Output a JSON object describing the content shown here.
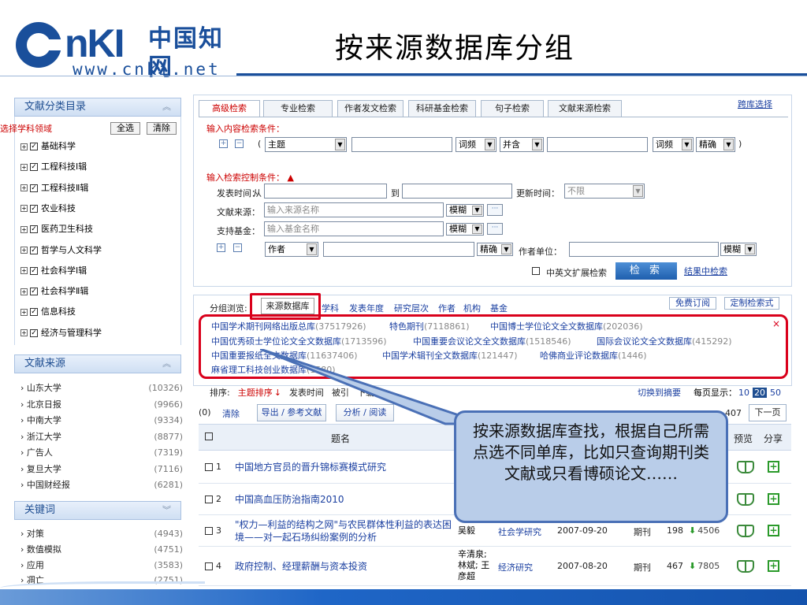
{
  "header": {
    "logo_text": "CNKI中国知网",
    "logo_url": "www.cnki.net",
    "page_title": "按来源数据库分组"
  },
  "sidebar": {
    "category_title": "文献分类目录",
    "pick_label": "选择学科领域",
    "select_all": "全选",
    "clear": "清除",
    "categories": [
      "基础科学",
      "工程科技Ⅰ辑",
      "工程科技Ⅱ辑",
      "农业科技",
      "医药卫生科技",
      "哲学与人文科学",
      "社会科学Ⅰ辑",
      "社会科学Ⅱ辑",
      "信息科技",
      "经济与管理科学"
    ],
    "source_title": "文献来源",
    "sources": [
      {
        "name": "山东大学",
        "count": "(10326)"
      },
      {
        "name": "北京日报",
        "count": "(9966)"
      },
      {
        "name": "中南大学",
        "count": "(9334)"
      },
      {
        "name": "浙江大学",
        "count": "(8877)"
      },
      {
        "name": "广告人",
        "count": "(7319)"
      },
      {
        "name": "复旦大学",
        "count": "(7116)"
      },
      {
        "name": "中国财经报",
        "count": "(6281)"
      }
    ],
    "keyword_title": "关键词",
    "keywords": [
      {
        "name": "对策",
        "count": "(4943)"
      },
      {
        "name": "数值模拟",
        "count": "(4751)"
      },
      {
        "name": "应用",
        "count": "(3583)"
      },
      {
        "name": "凋亡",
        "count": "(2751)"
      }
    ]
  },
  "search": {
    "tabs": [
      "高级检索",
      "专业检索",
      "作者发文检索",
      "科研基金检索",
      "句子检索",
      "文献来源检索"
    ],
    "cross_lib": "跨库选择",
    "content_cond_label": "输入内容检索条件：",
    "paren_open": "(",
    "paren_close": ")",
    "field1": "主题",
    "freq1": "词频",
    "logic": "并含",
    "freq2": "词频",
    "match2": "精确",
    "control_cond_label": "输入检索控制条件：",
    "pub_time_label": "发表时间：",
    "from": "从",
    "to": "到",
    "update_time_label": "更新时间：",
    "update_time_value": "不限",
    "source_label": "文献来源：",
    "source_placeholder": "输入来源名称",
    "source_match": "模糊",
    "fund_label": "支持基金：",
    "fund_placeholder": "输入基金名称",
    "fund_match": "模糊",
    "author_field": "作者",
    "author_match": "精确",
    "author_unit_label": "作者单位：",
    "unit_match": "模糊",
    "ext_label": "中英文扩展检索",
    "search_button": "检 索",
    "in_result": "结果中检索"
  },
  "grouping": {
    "label": "分组浏览:",
    "active_tab": "来源数据库",
    "links": [
      "学科",
      "发表年度",
      "研究层次",
      "作者",
      "机构",
      "基金"
    ],
    "free_sub": "免费订阅",
    "custom_sub": "定制检索式",
    "databases": [
      {
        "name": "中国学术期刊网络出版总库",
        "count": "(37517926)"
      },
      {
        "name": "特色期刊",
        "count": "(7118861)"
      },
      {
        "name": "中国博士学位论文全文数据库",
        "count": "(202036)"
      },
      {
        "name": "中国优秀硕士学位论文全文数据库",
        "count": "(1713596)"
      },
      {
        "name": "中国重要会议论文全文数据库",
        "count": "(1518546)"
      },
      {
        "name": "国际会议论文全文数据库",
        "count": "(415292)"
      },
      {
        "name": "中国重要报纸全文数据库",
        "count": "(11637406)"
      },
      {
        "name": "中国学术辑刊全文数据库",
        "count": "(121447)"
      },
      {
        "name": "哈佛商业评论数据库",
        "count": "(1446)"
      },
      {
        "name": "麻省理工科技创业数据库",
        "count": "(1580)"
      }
    ],
    "close": "×"
  },
  "results": {
    "sort_label": "排序:",
    "sort_options": [
      "主题排序",
      "发表时间",
      "被引",
      "下载"
    ],
    "sort_arrow": "↓",
    "view_summary": "切换到摘要",
    "per_page_label": "每页显示：",
    "per_page_opts": [
      "10",
      "20",
      "50"
    ],
    "selected_prefix": "(0)",
    "clear": "清除",
    "export": "导出 / 参考文献",
    "analyze": "分析 / 阅读",
    "page_count": "407",
    "next_page": "下一页",
    "col_title": "题名",
    "col_preview": "预览",
    "col_share": "分享",
    "rows": [
      {
        "num": "1",
        "title": "中国地方官员的晋升锦标赛模式研究",
        "author": "",
        "source": "",
        "date": "",
        "type": "",
        "cite": "",
        "dl": ""
      },
      {
        "num": "2",
        "title": "中国高血压防治指南2010",
        "author": "",
        "source": "",
        "date": "",
        "type": "",
        "cite": "",
        "dl": ""
      },
      {
        "num": "3",
        "title": "\"权力—利益的结构之网\"与农民群体性利益的表达困境——对一起石场纠纷案例的分析",
        "author": "吴毅",
        "source": "社会学研究",
        "date": "2007-09-20",
        "type": "期刊",
        "cite": "198",
        "dl": "4506"
      },
      {
        "num": "4",
        "title": "政府控制、经理薪酬与资本投资",
        "author": "辛清泉; 林斌; 王彦超",
        "source": "经济研究",
        "date": "2007-08-20",
        "type": "期刊",
        "cite": "467",
        "dl": "7805"
      }
    ]
  },
  "callout": {
    "text": "按来源数据库查找，根据自己所需点选不同单库，比如只查询期刊类文献或只看博硕论文……"
  },
  "colors": {
    "brand": "#1a4f9b",
    "highlight": "#d9001b",
    "link": "#1a3fa0",
    "callout_bg": "#b9cde9"
  }
}
